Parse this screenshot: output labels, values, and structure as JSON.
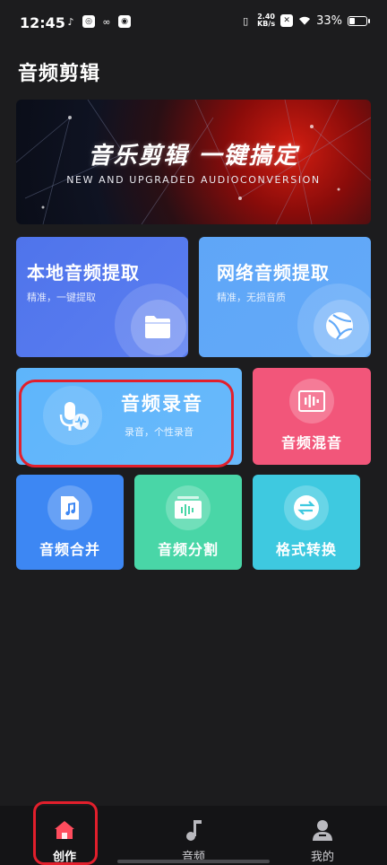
{
  "status_bar": {
    "time": "12:45",
    "net_speed_value": "2.40",
    "net_speed_unit": "KB/s",
    "battery": "33%",
    "battery_level": 0.33
  },
  "page": {
    "title": "音频剪辑"
  },
  "banner": {
    "title": "音乐剪辑  一键搞定",
    "subtitle": "NEW AND UPGRADED AUDIOCONVERSION"
  },
  "cards": {
    "local_extract": {
      "title": "本地音频提取",
      "subtitle": "精准，一键提取",
      "icon": "folder-icon"
    },
    "network_extract": {
      "title": "网络音频提取",
      "subtitle": "精准，无损音质",
      "icon": "globe-icon"
    },
    "record": {
      "title": "音频录音",
      "subtitle": "录音，个性录音",
      "icon": "microphone-icon"
    },
    "mix": {
      "title": "音频混音",
      "icon": "waveform-icon"
    },
    "merge": {
      "title": "音频合并",
      "icon": "music-file-icon"
    },
    "split": {
      "title": "音频分割",
      "icon": "split-wave-icon"
    },
    "format": {
      "title": "格式转换",
      "icon": "swap-arrows-icon"
    }
  },
  "bottom_nav": {
    "items": [
      {
        "label": "创作",
        "icon": "home-icon",
        "active": true
      },
      {
        "label": "音频",
        "icon": "music-note-icon",
        "active": false
      },
      {
        "label": "我的",
        "icon": "person-icon",
        "active": false
      }
    ]
  },
  "colors": {
    "background": "#1c1c1e",
    "local_card": "#4f74eb",
    "network_card": "#5fa6f7",
    "record_card": "#5eb5fb",
    "mix_card": "#f2567a",
    "merge_card": "#3d87f3",
    "split_card": "#49d6a7",
    "format_card": "#3ec9e0",
    "highlight": "#e21f2c"
  }
}
